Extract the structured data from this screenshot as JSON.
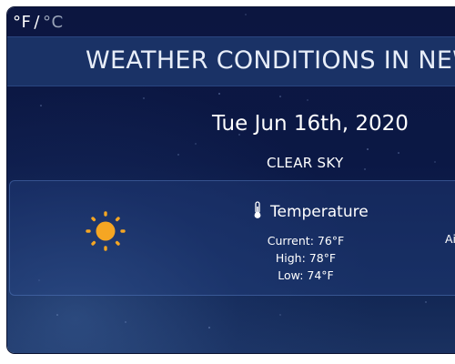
{
  "units": {
    "fahrenheit": "°F",
    "separator": "/",
    "celsius": "°C"
  },
  "header": {
    "title": "WEATHER CONDITIONS IN NEW"
  },
  "date": "Tue Jun 16th, 2020",
  "condition": "CLEAR SKY",
  "conditions": {
    "icon": "sun-icon",
    "temperature": {
      "icon": "thermometer-icon",
      "label": "Temperature",
      "current": "Current: 76°F",
      "high": "High: 78°F",
      "low": "Low: 74°F"
    },
    "next_column": {
      "header_fragment": "+",
      "line_fragment": "Ai"
    }
  },
  "colors": {
    "background": "#0b1845",
    "header_bar": "#1a3266",
    "sun": "#f5a623",
    "text": "#ffffff",
    "inactive_unit": "#9aa4b8"
  }
}
